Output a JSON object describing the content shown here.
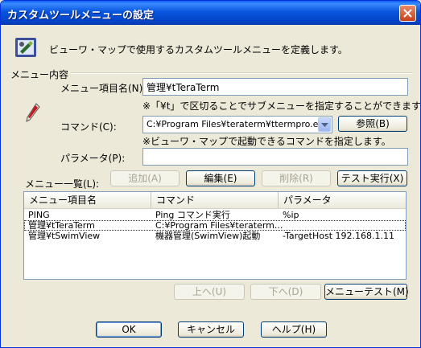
{
  "window": {
    "title": "カスタムツールメニューの設定"
  },
  "description": "ビューワ・マップで使用するカスタムツールメニューを定義します。",
  "group_label": "メニュー内容",
  "form": {
    "item_name_label": "メニュー項目名(N):",
    "item_name_value": "管理¥tTeraTerm",
    "item_name_hint": "※「¥t」で区切ることでサブメニューを指定することができます。",
    "command_label": "コマンド(C):",
    "command_value": "C:¥Program Files¥teraterm¥ttermpro.exe",
    "browse_label": "参照(B)",
    "command_hint": "※ビューワ・マップで起動できるコマンドを指定します。",
    "parameter_label": "パラメータ(P):",
    "parameter_value": ""
  },
  "list_label": "メニュー一覧(L):",
  "list_buttons": {
    "add": "追加(A)",
    "edit": "編集(E)",
    "delete": "削除(R)",
    "test_run": "テスト実行(X)"
  },
  "table": {
    "columns": [
      "メニュー項目名",
      "コマンド",
      "パラメータ"
    ],
    "rows": [
      [
        "PING",
        "Ping コマンド実行",
        "%ip"
      ],
      [
        "管理¥tTeraTerm",
        "C:¥Program Files¥teraterm...",
        ""
      ],
      [
        "管理¥tSwimView",
        "機器管理(SwimView)起動",
        "-TargetHost 192.168.1.11"
      ]
    ]
  },
  "order_buttons": {
    "up": "上へ(U)",
    "down": "下へ(D)",
    "menu_test": "メニューテスト(M)"
  },
  "dialog_buttons": {
    "ok": "OK",
    "cancel": "キャンセル",
    "help": "ヘルプ(H)"
  }
}
